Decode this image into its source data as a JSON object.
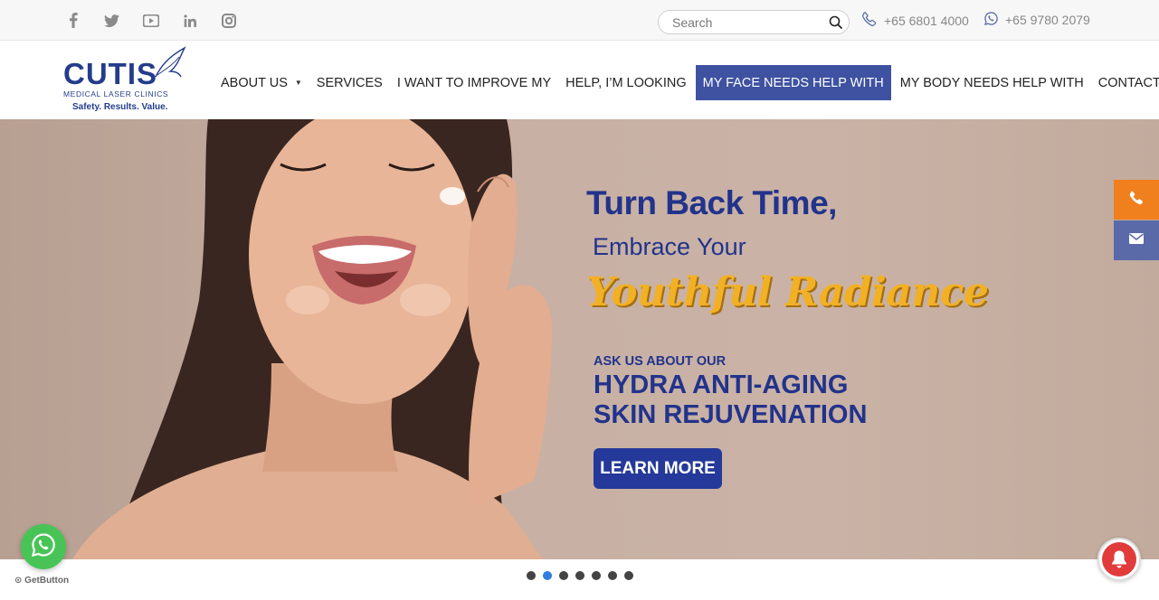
{
  "topbar": {
    "social": [
      "facebook-icon",
      "twitter-icon",
      "youtube-icon",
      "linkedin-icon",
      "instagram-icon"
    ],
    "search": {
      "placeholder": "Search"
    },
    "phone": "+65 6801 4000",
    "whatsapp": "+65 9780 2079"
  },
  "logo": {
    "brand": "CUTIS",
    "subtitle": "MEDICAL LASER CLINICS",
    "tagline": "Safety. Results. Value."
  },
  "nav": {
    "items": [
      {
        "label": "ABOUT US",
        "has_dropdown": true
      },
      {
        "label": "SERVICES"
      },
      {
        "label": "I WANT TO IMPROVE MY"
      },
      {
        "label": "HELP, I’M LOOKING"
      },
      {
        "label": "MY FACE NEEDS HELP WITH",
        "active": true
      },
      {
        "label": "MY BODY NEEDS HELP WITH"
      },
      {
        "label": "CONTACT US"
      }
    ]
  },
  "hero": {
    "line1": "Turn Back Time,",
    "line2": "Embrace Your",
    "line3": "Youthful Radiance",
    "ask": "ASK US ABOUT OUR",
    "treatment1": "HYDRA ANTI-AGING",
    "treatment2": "SKIN REJUVENATION",
    "cta": "LEARN MORE"
  },
  "slider": {
    "total": 7,
    "active_index": 1
  },
  "widgets": {
    "getbutton": "GetButton"
  },
  "colors": {
    "brand_blue": "#253c8c",
    "nav_active": "#3f52a1",
    "accent_gold": "#f2b124",
    "side_phone": "#f07f1d",
    "side_mail": "#5a69a8",
    "whatsapp": "#48c456"
  }
}
